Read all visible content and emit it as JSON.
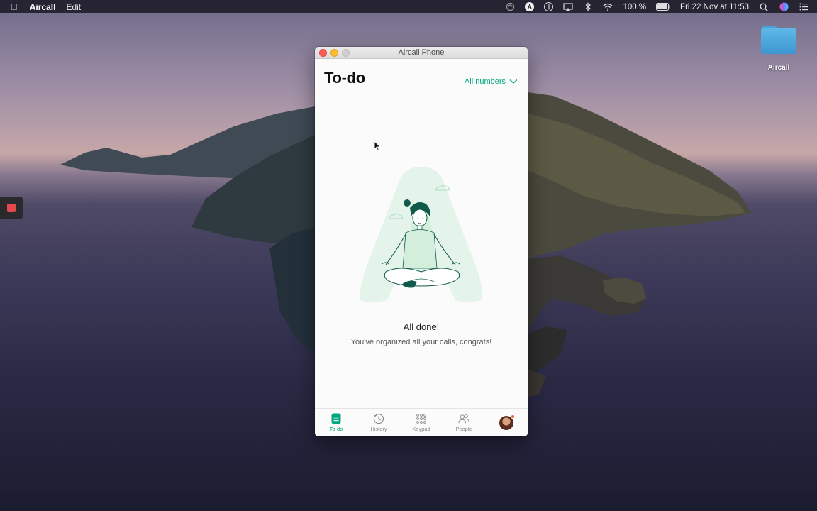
{
  "menubar": {
    "app_name": "Aircall",
    "menu_edit": "Edit",
    "battery": "100 %",
    "datetime": "Fri 22 Nov at  11:53",
    "icons": [
      "apple-icon",
      "sync-icon",
      "aircall-status-icon",
      "onepassword-icon",
      "airplay-icon",
      "bluetooth-icon",
      "wifi-icon",
      "battery-icon",
      "spotlight-icon",
      "siri-icon",
      "control-center-icon"
    ]
  },
  "desktop": {
    "folder_label": "Aircall"
  },
  "window": {
    "title": "Aircall Phone",
    "page_title": "To-do",
    "filter_label": "All numbers",
    "empty_title": "All done!",
    "empty_subtitle": "You've organized all your calls, congrats!",
    "nav": [
      {
        "label": "To-do",
        "icon": "todo-icon",
        "active": true
      },
      {
        "label": "History",
        "icon": "history-icon",
        "active": false
      },
      {
        "label": "Keypad",
        "icon": "keypad-icon",
        "active": false
      },
      {
        "label": "People",
        "icon": "people-icon",
        "active": false
      }
    ]
  },
  "colors": {
    "accent": "#00a67e",
    "notification": "#f25c3b"
  }
}
